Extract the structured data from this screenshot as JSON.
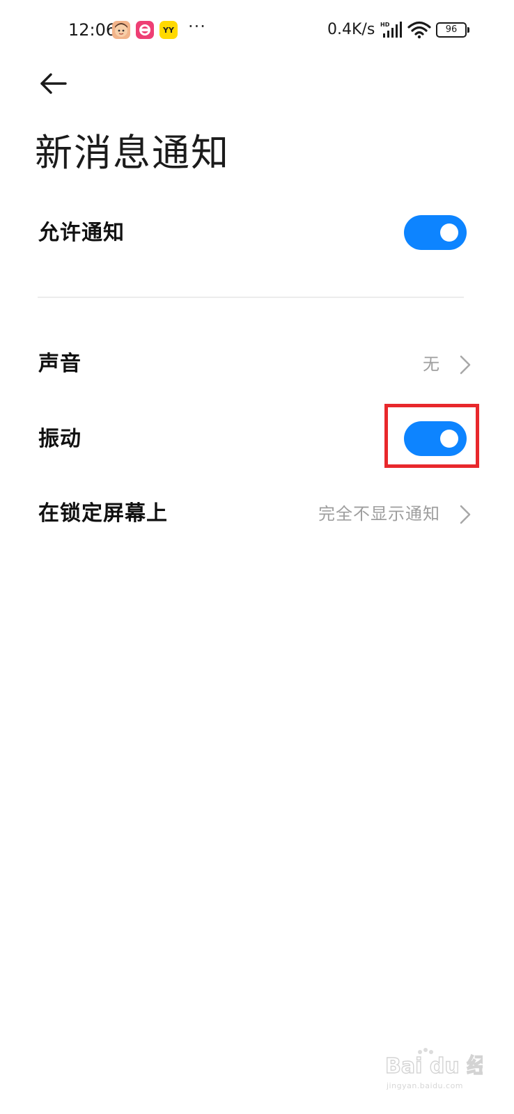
{
  "status_bar": {
    "time": "12:06",
    "more": "···",
    "net_speed": "0.4K/s",
    "signal_badge": "HD",
    "battery": "96",
    "app_icons": [
      "avatar-app-icon",
      "music-app-icon",
      "yy-app-icon"
    ],
    "yy_label": "YY"
  },
  "header": {
    "back_icon": "arrow-left-icon",
    "title": "新消息通知"
  },
  "settings": {
    "allow_notifications": {
      "label": "允许通知",
      "enabled": true
    },
    "sound": {
      "label": "声音",
      "value": "无"
    },
    "vibration": {
      "label": "振动",
      "enabled": true
    },
    "lock_screen": {
      "label": "在锁定屏幕上",
      "value": "完全不显示通知"
    }
  },
  "watermark": {
    "brand": "Bai du 经验",
    "url": "jingyan.baidu.com"
  },
  "colors": {
    "toggle_on": "#0d84ff",
    "highlight": "#e8282c",
    "secondary_text": "#9e9e9e",
    "divider": "#ececec"
  }
}
